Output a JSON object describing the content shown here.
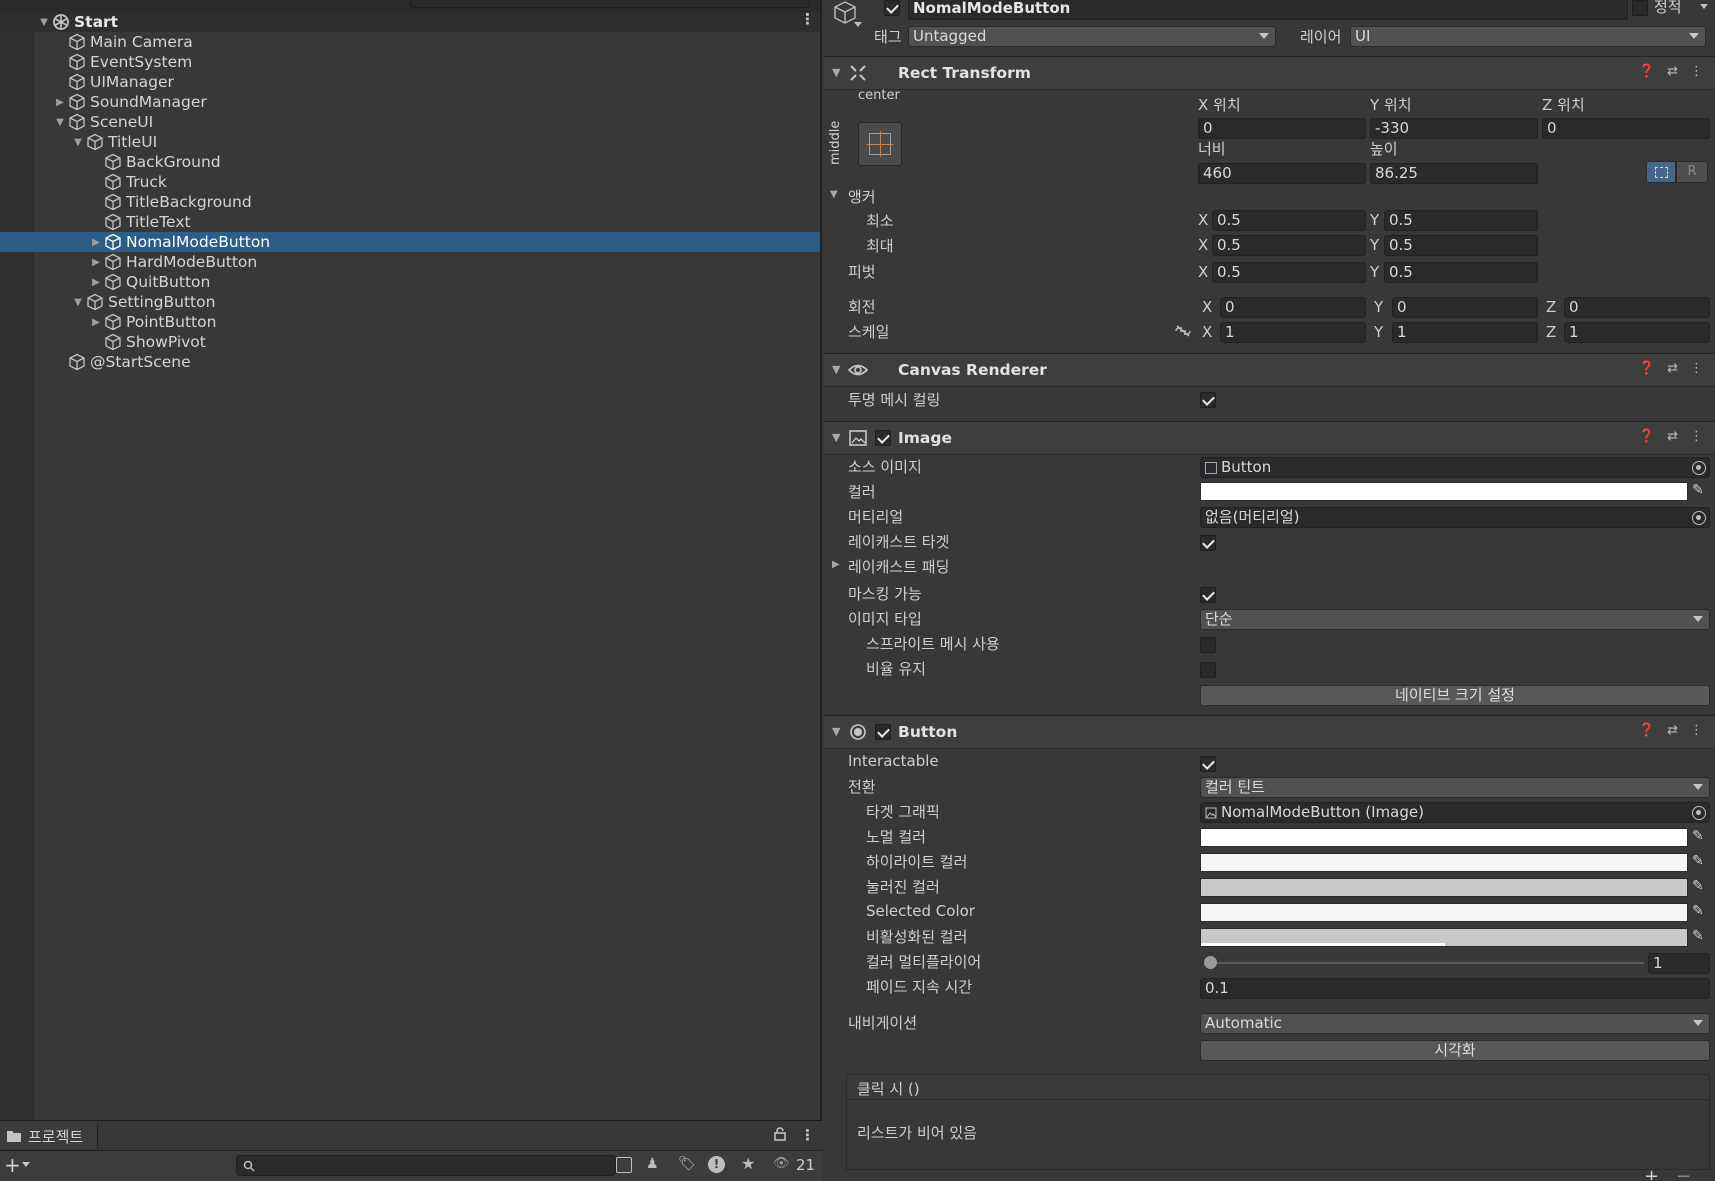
{
  "hierarchy": {
    "rows": [
      {
        "label": "Start",
        "depth": 0,
        "fold": "open",
        "root": true
      },
      {
        "label": "Main Camera",
        "depth": 1,
        "fold": ""
      },
      {
        "label": "EventSystem",
        "depth": 1,
        "fold": ""
      },
      {
        "label": "UIManager",
        "depth": 1,
        "fold": ""
      },
      {
        "label": "SoundManager",
        "depth": 1,
        "fold": "closed"
      },
      {
        "label": "SceneUI",
        "depth": 1,
        "fold": "open"
      },
      {
        "label": "TitleUI",
        "depth": 2,
        "fold": "open"
      },
      {
        "label": "BackGround",
        "depth": 3,
        "fold": ""
      },
      {
        "label": "Truck",
        "depth": 3,
        "fold": ""
      },
      {
        "label": "TitleBackground",
        "depth": 3,
        "fold": ""
      },
      {
        "label": "TitleText",
        "depth": 3,
        "fold": ""
      },
      {
        "label": "NomalModeButton",
        "depth": 3,
        "fold": "closed",
        "selected": true
      },
      {
        "label": "HardModeButton",
        "depth": 3,
        "fold": "closed"
      },
      {
        "label": "QuitButton",
        "depth": 3,
        "fold": "closed"
      },
      {
        "label": "SettingButton",
        "depth": 2,
        "fold": "open"
      },
      {
        "label": "PointButton",
        "depth": 3,
        "fold": "closed"
      },
      {
        "label": "ShowPivot",
        "depth": 3,
        "fold": ""
      },
      {
        "label": "@StartScene",
        "depth": 1,
        "fold": ""
      }
    ]
  },
  "project": {
    "tab_label": "프로젝트",
    "hidden_count": "21"
  },
  "inspector": {
    "object_name": "NomalModeButton",
    "static_label": "정적",
    "tag_label": "태그",
    "tag_value": "Untagged",
    "layer_label": "레이어",
    "layer_value": "UI",
    "rect_transform": {
      "title": "Rect Transform",
      "anchor_h": "center",
      "anchor_v": "middle",
      "pos_x_label": "X 위치",
      "pos_y_label": "Y 위치",
      "pos_z_label": "Z 위치",
      "pos_x": "0",
      "pos_y": "-330",
      "pos_z": "0",
      "width_label": "너비",
      "height_label": "높이",
      "width": "460",
      "height": "86.25",
      "anchors_label": "앵커",
      "min_label": "최소",
      "max_label": "최대",
      "min_x": "0.5",
      "min_y": "0.5",
      "max_x": "0.5",
      "max_y": "0.5",
      "pivot_label": "피벗",
      "pivot_x": "0.5",
      "pivot_y": "0.5",
      "rotation_label": "회전",
      "rot_x": "0",
      "rot_y": "0",
      "rot_z": "0",
      "scale_label": "스케일",
      "scale_x": "1",
      "scale_y": "1",
      "scale_z": "1",
      "x": "X",
      "y": "Y",
      "z": "Z"
    },
    "canvas_renderer": {
      "title": "Canvas Renderer",
      "cull_label": "투명 메시 컬링"
    },
    "image": {
      "title": "Image",
      "source_label": "소스 이미지",
      "source_value": "Button",
      "color_label": "컬러",
      "material_label": "머티리얼",
      "material_value": "없음(머티리얼)",
      "raycast_target_label": "레이캐스트 타겟",
      "raycast_padding_label": "레이캐스트 패딩",
      "maskable_label": "마스킹 가능",
      "image_type_label": "이미지 타입",
      "image_type_value": "단순",
      "use_sprite_mesh_label": "스프라이트 메시 사용",
      "preserve_aspect_label": "비율 유지",
      "native_size_button": "네이티브 크기 설정"
    },
    "button": {
      "title": "Button",
      "interactable_label": "Interactable",
      "transition_label": "전환",
      "transition_value": "컬러 틴트",
      "target_graphic_label": "타겟 그래픽",
      "target_graphic_value": "NomalModeButton (Image)",
      "normal_color_label": "노멀 컬러",
      "highlight_color_label": "하이라이트 컬러",
      "pressed_color_label": "눌러진 컬러",
      "selected_color_label": "Selected Color",
      "disabled_color_label": "비활성화된 컬러",
      "multiplier_label": "컬러 멀티플라이어",
      "multiplier_value": "1",
      "multiplier_fraction": 0,
      "fade_label": "페이드 지속 시간",
      "fade_value": "0.1",
      "navigation_label": "내비게이션",
      "navigation_value": "Automatic",
      "visualize_button": "시각화",
      "onclick_label": "클릭 시 ()",
      "onclick_empty": "리스트가 비어 있음"
    },
    "colors": {
      "image_color": "#ffffff",
      "normal": "#ffffff",
      "highlight": "#f5f5f5",
      "pressed": "#c8c8c8",
      "selected": "#f5f5f5",
      "disabled": "#c8c8c8"
    }
  }
}
